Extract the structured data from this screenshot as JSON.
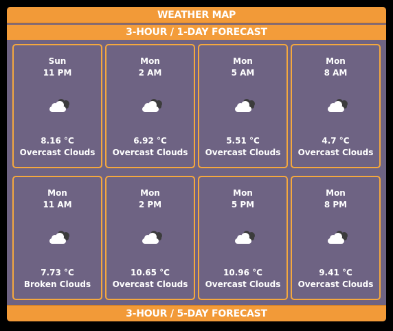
{
  "header": {
    "title": "WEATHER MAP"
  },
  "tabs": {
    "one_day": "3-HOUR / 1-DAY FORECAST",
    "five_day": "3-HOUR / 5-DAY FORECAST"
  },
  "colors": {
    "accent": "#f29a38",
    "panel": "#6e6383",
    "card_border": "#f5a83e"
  },
  "forecast": [
    {
      "day": "Sun",
      "time": "11 PM",
      "icon": "overcast-clouds-icon",
      "temp": "8.16 °C",
      "desc": "Overcast Clouds"
    },
    {
      "day": "Mon",
      "time": "2 AM",
      "icon": "overcast-clouds-icon",
      "temp": "6.92 °C",
      "desc": "Overcast Clouds"
    },
    {
      "day": "Mon",
      "time": "5 AM",
      "icon": "overcast-clouds-icon",
      "temp": "5.51 °C",
      "desc": "Overcast Clouds"
    },
    {
      "day": "Mon",
      "time": "8 AM",
      "icon": "overcast-clouds-icon",
      "temp": "4.7 °C",
      "desc": "Overcast Clouds"
    },
    {
      "day": "Mon",
      "time": "11 AM",
      "icon": "broken-clouds-icon",
      "temp": "7.73 °C",
      "desc": "Broken Clouds"
    },
    {
      "day": "Mon",
      "time": "2 PM",
      "icon": "overcast-clouds-icon",
      "temp": "10.65 °C",
      "desc": "Overcast Clouds"
    },
    {
      "day": "Mon",
      "time": "5 PM",
      "icon": "overcast-clouds-icon",
      "temp": "10.96 °C",
      "desc": "Overcast Clouds"
    },
    {
      "day": "Mon",
      "time": "8 PM",
      "icon": "overcast-clouds-icon",
      "temp": "9.41 °C",
      "desc": "Overcast Clouds"
    }
  ]
}
